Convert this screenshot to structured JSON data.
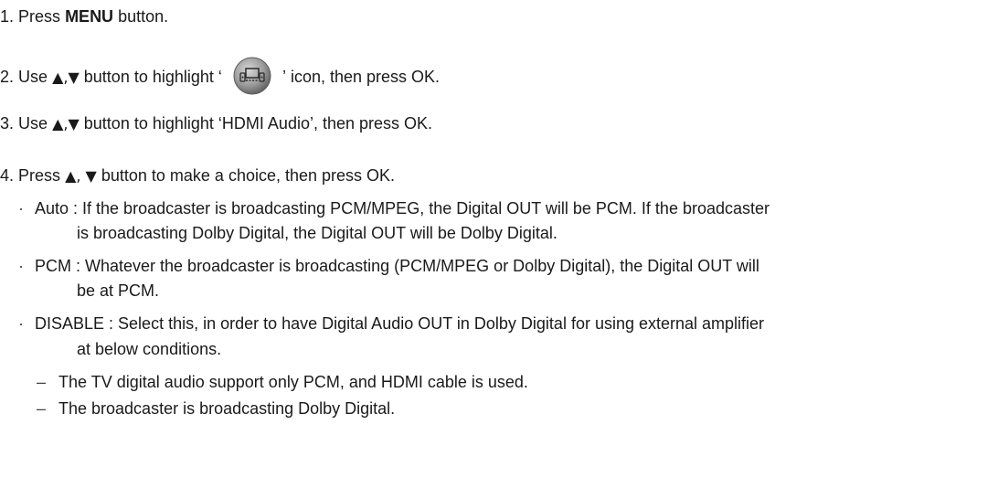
{
  "steps": {
    "s1": {
      "num": "1.",
      "pre": "Press",
      "bold": "MENU",
      "post": "button."
    },
    "s2": {
      "num": "2.",
      "pre": "Use",
      "arrows": "▲,▼",
      "mid": "button to highlight",
      "open_quote": "‘",
      "close_quote": "’",
      "icon": "setup-tv-speaker-icon",
      "post": "icon, then press OK."
    },
    "s3": {
      "num": "3.",
      "pre": "Use",
      "arrows": "▲,▼",
      "mid": "button to highlight",
      "quoted": "‘HDMI Audio’",
      "post": ", then press OK."
    },
    "s4": {
      "num": "4.",
      "pre": "Press",
      "arrows": "▲, ▼",
      "post": "button to make a choice, then press OK."
    }
  },
  "options": {
    "bullet": "·",
    "auto": {
      "line1": "Auto : If the broadcaster is broadcasting PCM/MPEG, the Digital OUT will be PCM. If the broadcaster",
      "line2": "is broadcasting Dolby Digital, the Digital OUT will be Dolby Digital."
    },
    "pcm": {
      "line1": "PCM : Whatever the broadcaster is broadcasting (PCM/MPEG or Dolby Digital), the Digital OUT will",
      "line2": "be at PCM."
    },
    "disable": {
      "line1": "DISABLE : Select this, in order to have Digital Audio OUT in Dolby Digital for using external amplifier",
      "line2": "at below conditions."
    }
  },
  "conditions": {
    "dash": "–",
    "c1": "The TV digital audio support only PCM, and HDMI cable is used.",
    "c2": "The broadcaster is broadcasting Dolby Digital."
  },
  "colors": {
    "text": "#1a1a1a",
    "icon_fill": "#9a9a9a",
    "icon_edge": "#5a5a5a"
  }
}
